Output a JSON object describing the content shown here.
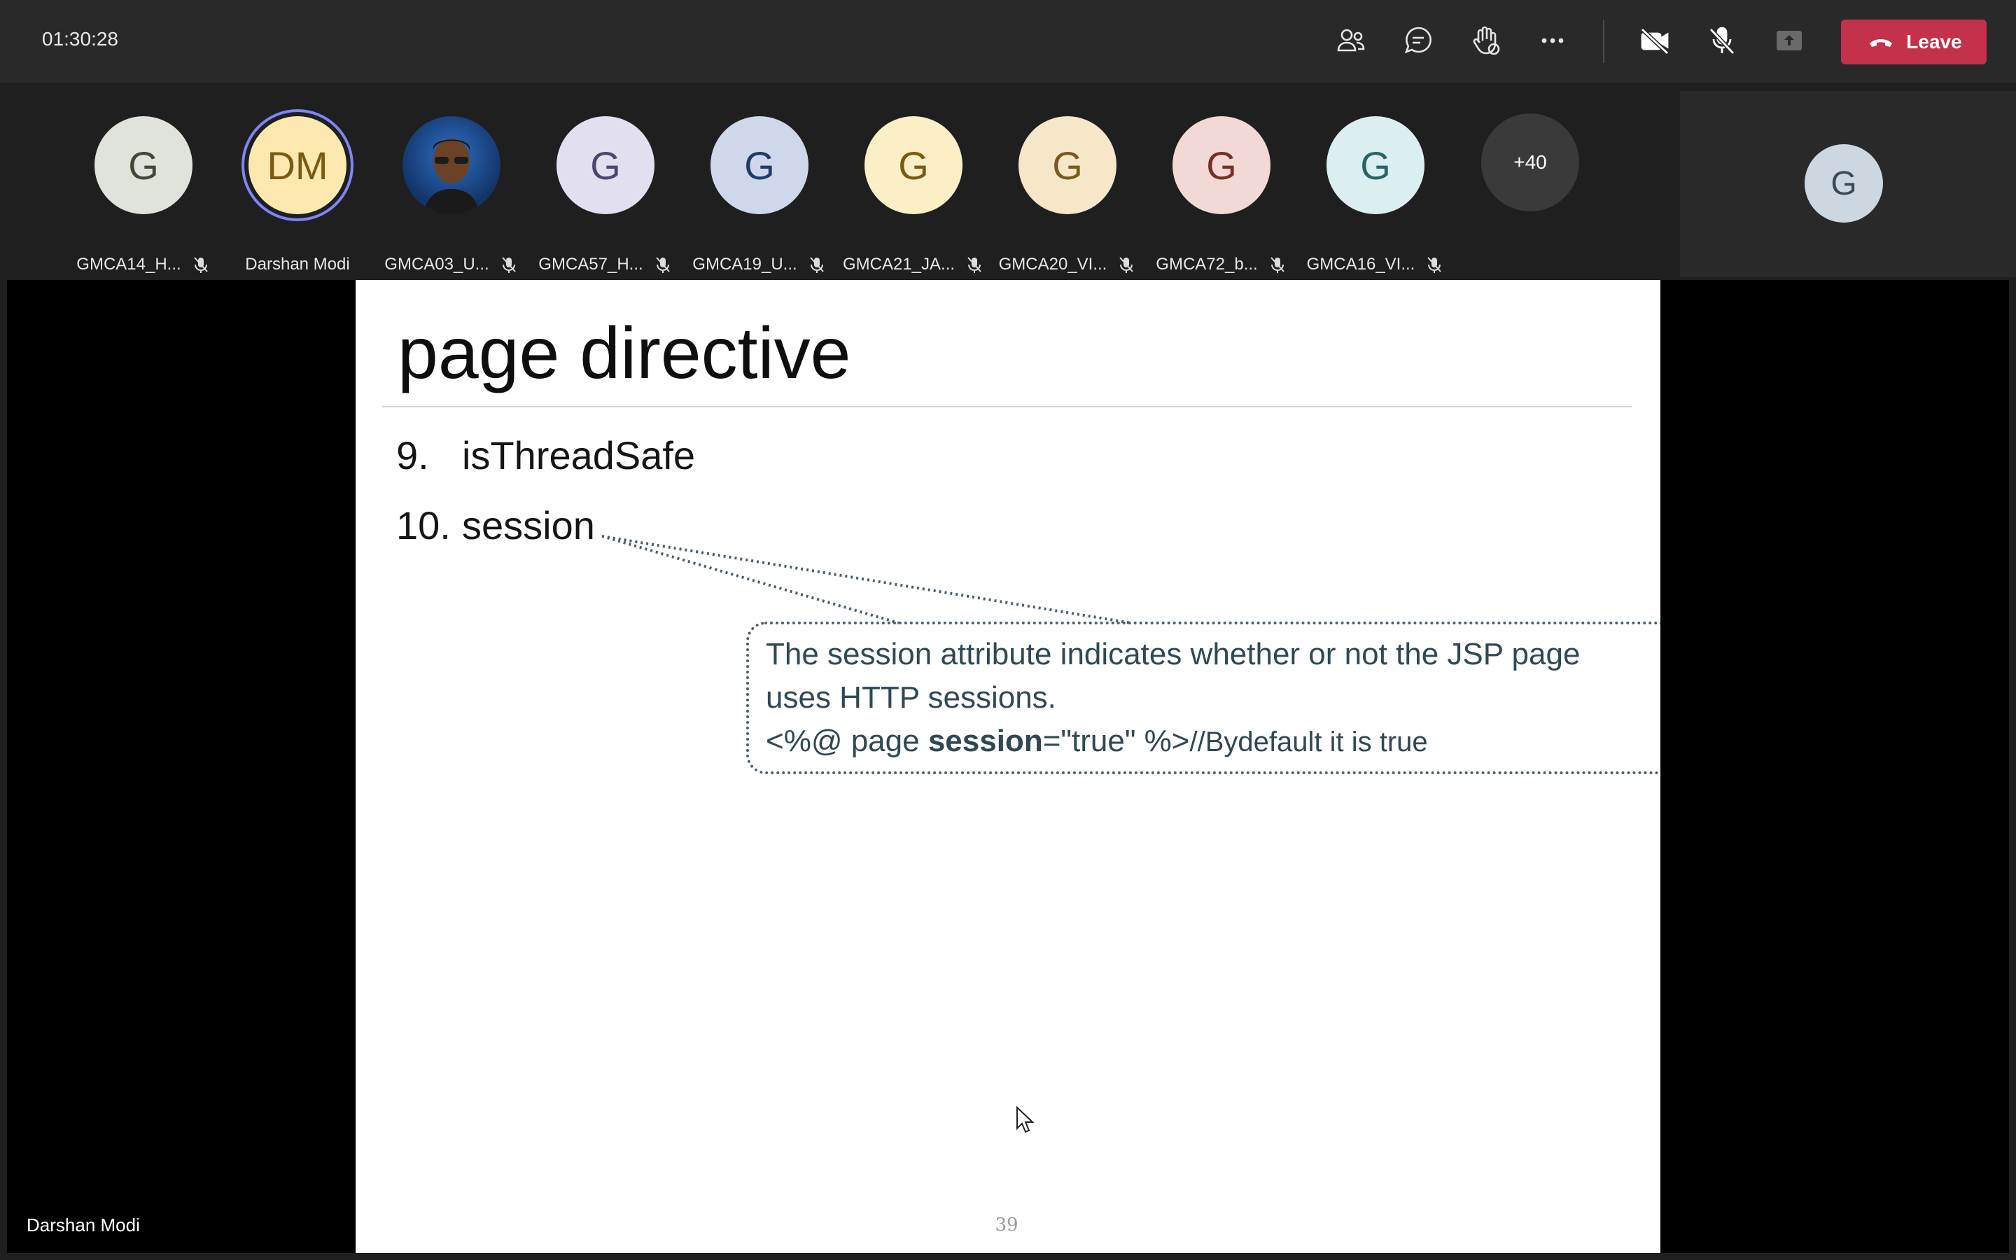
{
  "meeting": {
    "elapsed": "01:30:28"
  },
  "toolbar": {
    "icons": [
      "people-icon",
      "chat-icon",
      "raise-hand-icon",
      "more-options-icon",
      "camera-off-icon",
      "mic-off-icon",
      "share-screen-icon"
    ],
    "leave_label": "Leave"
  },
  "participants": [
    {
      "initials": "G",
      "name": "GMCA14_H...",
      "bg": "#dfe3dc",
      "fg": "#3d4a36",
      "muted": true
    },
    {
      "initials": "DM",
      "name": "Darshan Modi",
      "bg": "#fde9b0",
      "fg": "#7a5a12",
      "muted": false,
      "speaking": true
    },
    {
      "initials": "",
      "name": "GMCA03_U...",
      "bg": "#1c4b8f",
      "fg": "#ffffff",
      "muted": true,
      "photo": true
    },
    {
      "initials": "G",
      "name": "GMCA57_H...",
      "bg": "#e2e0ef",
      "fg": "#4b4870",
      "muted": true
    },
    {
      "initials": "G",
      "name": "GMCA19_U...",
      "bg": "#cfd8ea",
      "fg": "#1f3a6b",
      "muted": true
    },
    {
      "initials": "G",
      "name": "GMCA21_JA...",
      "bg": "#fcefc6",
      "fg": "#7a5a12",
      "muted": true
    },
    {
      "initials": "G",
      "name": "GMCA20_VI...",
      "bg": "#f6e7c9",
      "fg": "#7b5a1e",
      "muted": true
    },
    {
      "initials": "G",
      "name": "GMCA72_b...",
      "bg": "#f3d9d6",
      "fg": "#7a2f26",
      "muted": true
    },
    {
      "initials": "G",
      "name": "GMCA16_VI...",
      "bg": "#dbeff0",
      "fg": "#2b6466",
      "muted": true
    }
  ],
  "overflow_count": "+40",
  "self_view": {
    "initials": "G"
  },
  "presenter_name": "Darshan Modi",
  "slide": {
    "title": "page directive",
    "items": [
      {
        "num": "9.",
        "text": "isThreadSafe"
      },
      {
        "num": "10.",
        "text": "session"
      }
    ],
    "callout": {
      "line1": "The session attribute indicates whether or not the JSP page",
      "line2": "uses HTTP sessions.",
      "line3_prefix": "<%@ page ",
      "line3_bold": "session",
      "line3_mid": "=\"true\"  %>",
      "line3_comment": "//Bydefault it is true"
    },
    "page_number": "39"
  },
  "colors": {
    "leave": "#c4314b",
    "speaking_ring": "#7f85f5",
    "toolbar_bg": "#292929"
  }
}
